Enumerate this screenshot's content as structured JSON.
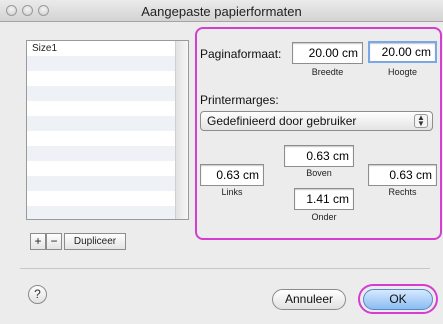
{
  "window": {
    "title": "Aangepaste papierformaten"
  },
  "list": {
    "items": [
      "Size1"
    ]
  },
  "list_buttons": {
    "add": "+",
    "remove": "−",
    "duplicate": "Dupliceer"
  },
  "paper_size": {
    "label": "Paginaformaat:",
    "width_value": "20.00 cm",
    "width_label": "Breedte",
    "height_value": "20.00 cm",
    "height_label": "Hoogte"
  },
  "margins": {
    "label": "Printermarges:",
    "preset": "Gedefinieerd door gebruiker",
    "top_value": "0.63 cm",
    "top_label": "Boven",
    "left_value": "0.63 cm",
    "left_label": "Links",
    "right_value": "0.63 cm",
    "right_label": "Rechts",
    "bottom_value": "1.41 cm",
    "bottom_label": "Onder"
  },
  "footer": {
    "help": "?",
    "cancel": "Annuleer",
    "ok": "OK"
  },
  "colors": {
    "highlight": "#d53dd0",
    "default_button": "#8bbcf2"
  }
}
